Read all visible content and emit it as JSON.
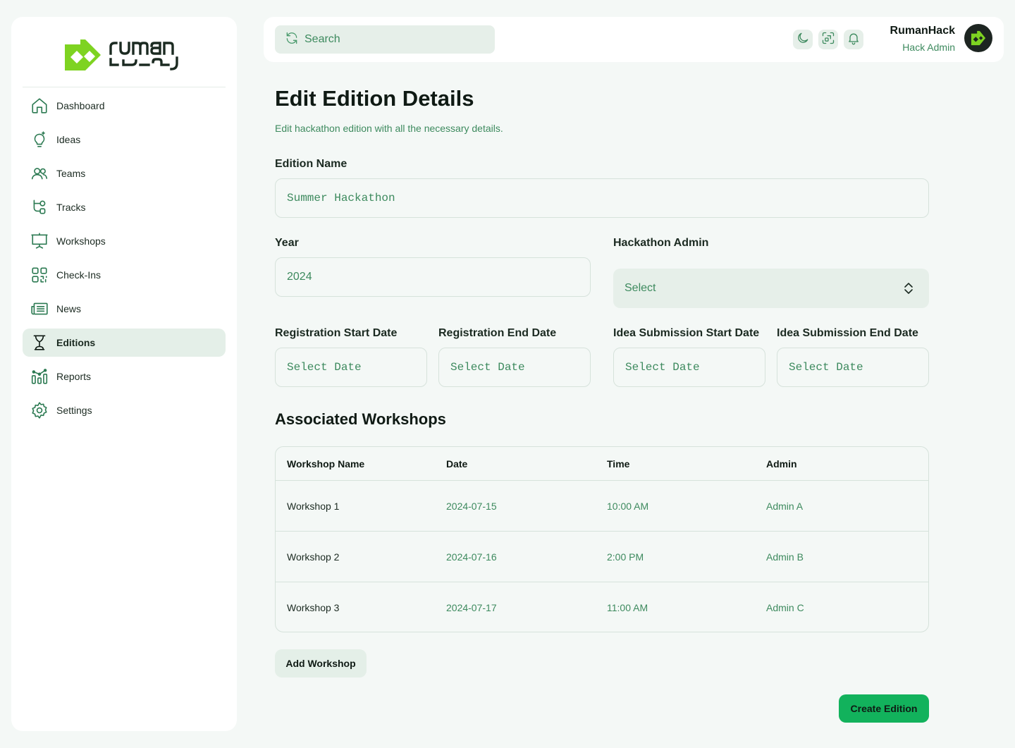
{
  "brand": {
    "logo_latin": "ruman",
    "logo_arabic": "رمان",
    "accent": "#7ed321",
    "primary": "#12b25c"
  },
  "sidebar": {
    "items": [
      {
        "label": "Dashboard",
        "icon": "home-icon",
        "active": false
      },
      {
        "label": "Ideas",
        "icon": "lightbulb-icon",
        "active": false
      },
      {
        "label": "Teams",
        "icon": "users-icon",
        "active": false
      },
      {
        "label": "Tracks",
        "icon": "route-icon",
        "active": false
      },
      {
        "label": "Workshops",
        "icon": "presentation-icon",
        "active": false
      },
      {
        "label": "Check-Ins",
        "icon": "qr-code-icon",
        "active": false
      },
      {
        "label": "News",
        "icon": "newspaper-icon",
        "active": false
      },
      {
        "label": "Editions",
        "icon": "trophy-icon",
        "active": true
      },
      {
        "label": "Reports",
        "icon": "chart-icon",
        "active": false
      },
      {
        "label": "Settings",
        "icon": "gear-icon",
        "active": false
      }
    ]
  },
  "header": {
    "search_placeholder": "Search",
    "icons": [
      "moon-icon",
      "scan-icon",
      "bell-icon"
    ],
    "user_name": "RumanHack",
    "user_role": "Hack Admin"
  },
  "page": {
    "title": "Edit Edition Details",
    "subtitle": "Edit hackathon edition with all the necessary details."
  },
  "form": {
    "edition_name_label": "Edition Name",
    "edition_name_placeholder": "Summer Hackathon",
    "year_label": "Year",
    "year_placeholder": "2024",
    "admin_label": "Hackathon Admin",
    "admin_value": "Select",
    "reg_start_label": "Registration Start Date",
    "reg_end_label": "Registration End Date",
    "idea_start_label": "Idea Submission Start Date",
    "idea_end_label": "Idea Submission End Date",
    "date_placeholder": "Select Date"
  },
  "workshops": {
    "title": "Associated Workshops",
    "columns": [
      "Workshop Name",
      "Date",
      "Time",
      "Admin"
    ],
    "rows": [
      {
        "name": "Workshop 1",
        "date": "2024-07-15",
        "time": "10:00 AM",
        "admin": "Admin A"
      },
      {
        "name": "Workshop 2",
        "date": "2024-07-16",
        "time": "2:00 PM",
        "admin": "Admin B"
      },
      {
        "name": "Workshop 3",
        "date": "2024-07-17",
        "time": "11:00 AM",
        "admin": "Admin C"
      }
    ],
    "add_label": "Add Workshop"
  },
  "actions": {
    "create_label": "Create Edition"
  }
}
